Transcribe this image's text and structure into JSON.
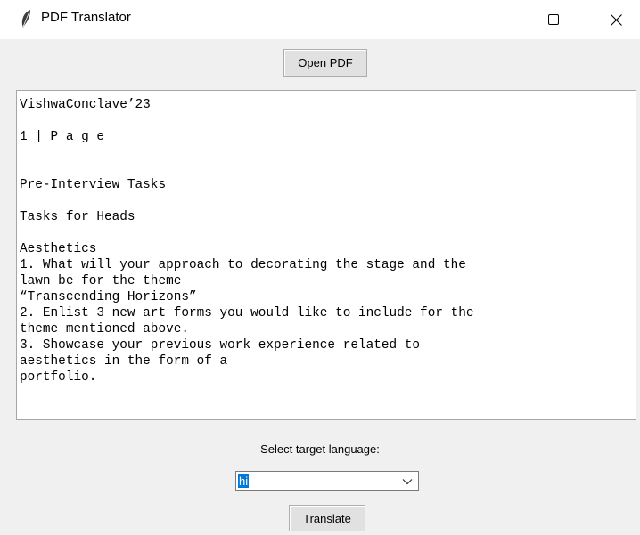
{
  "window": {
    "title": "PDF Translator",
    "icon": "feather-icon",
    "controls": [
      "minimize-icon",
      "maximize-icon",
      "close-icon"
    ]
  },
  "toolbar": {
    "open_label": "Open PDF"
  },
  "document": {
    "lines": [
      "VishwaConclave’23",
      "",
      "1 | P a g e",
      "",
      "",
      "Pre-Interview Tasks",
      "",
      "Tasks for Heads",
      "",
      "Aesthetics",
      "1. What will your approach to decorating the stage and the",
      "lawn be for the theme",
      "“Transcending Horizons”",
      "2. Enlist 3 new art forms you would like to include for the",
      "theme mentioned above.",
      "3. Showcase your previous work experience related to",
      "aesthetics in the form of a",
      "portfolio."
    ]
  },
  "language": {
    "label": "Select target language:",
    "selected": "hi"
  },
  "actions": {
    "translate_label": "Translate"
  },
  "colors": {
    "window_bg": "#f0f0f0",
    "selection": "#0078d7"
  }
}
